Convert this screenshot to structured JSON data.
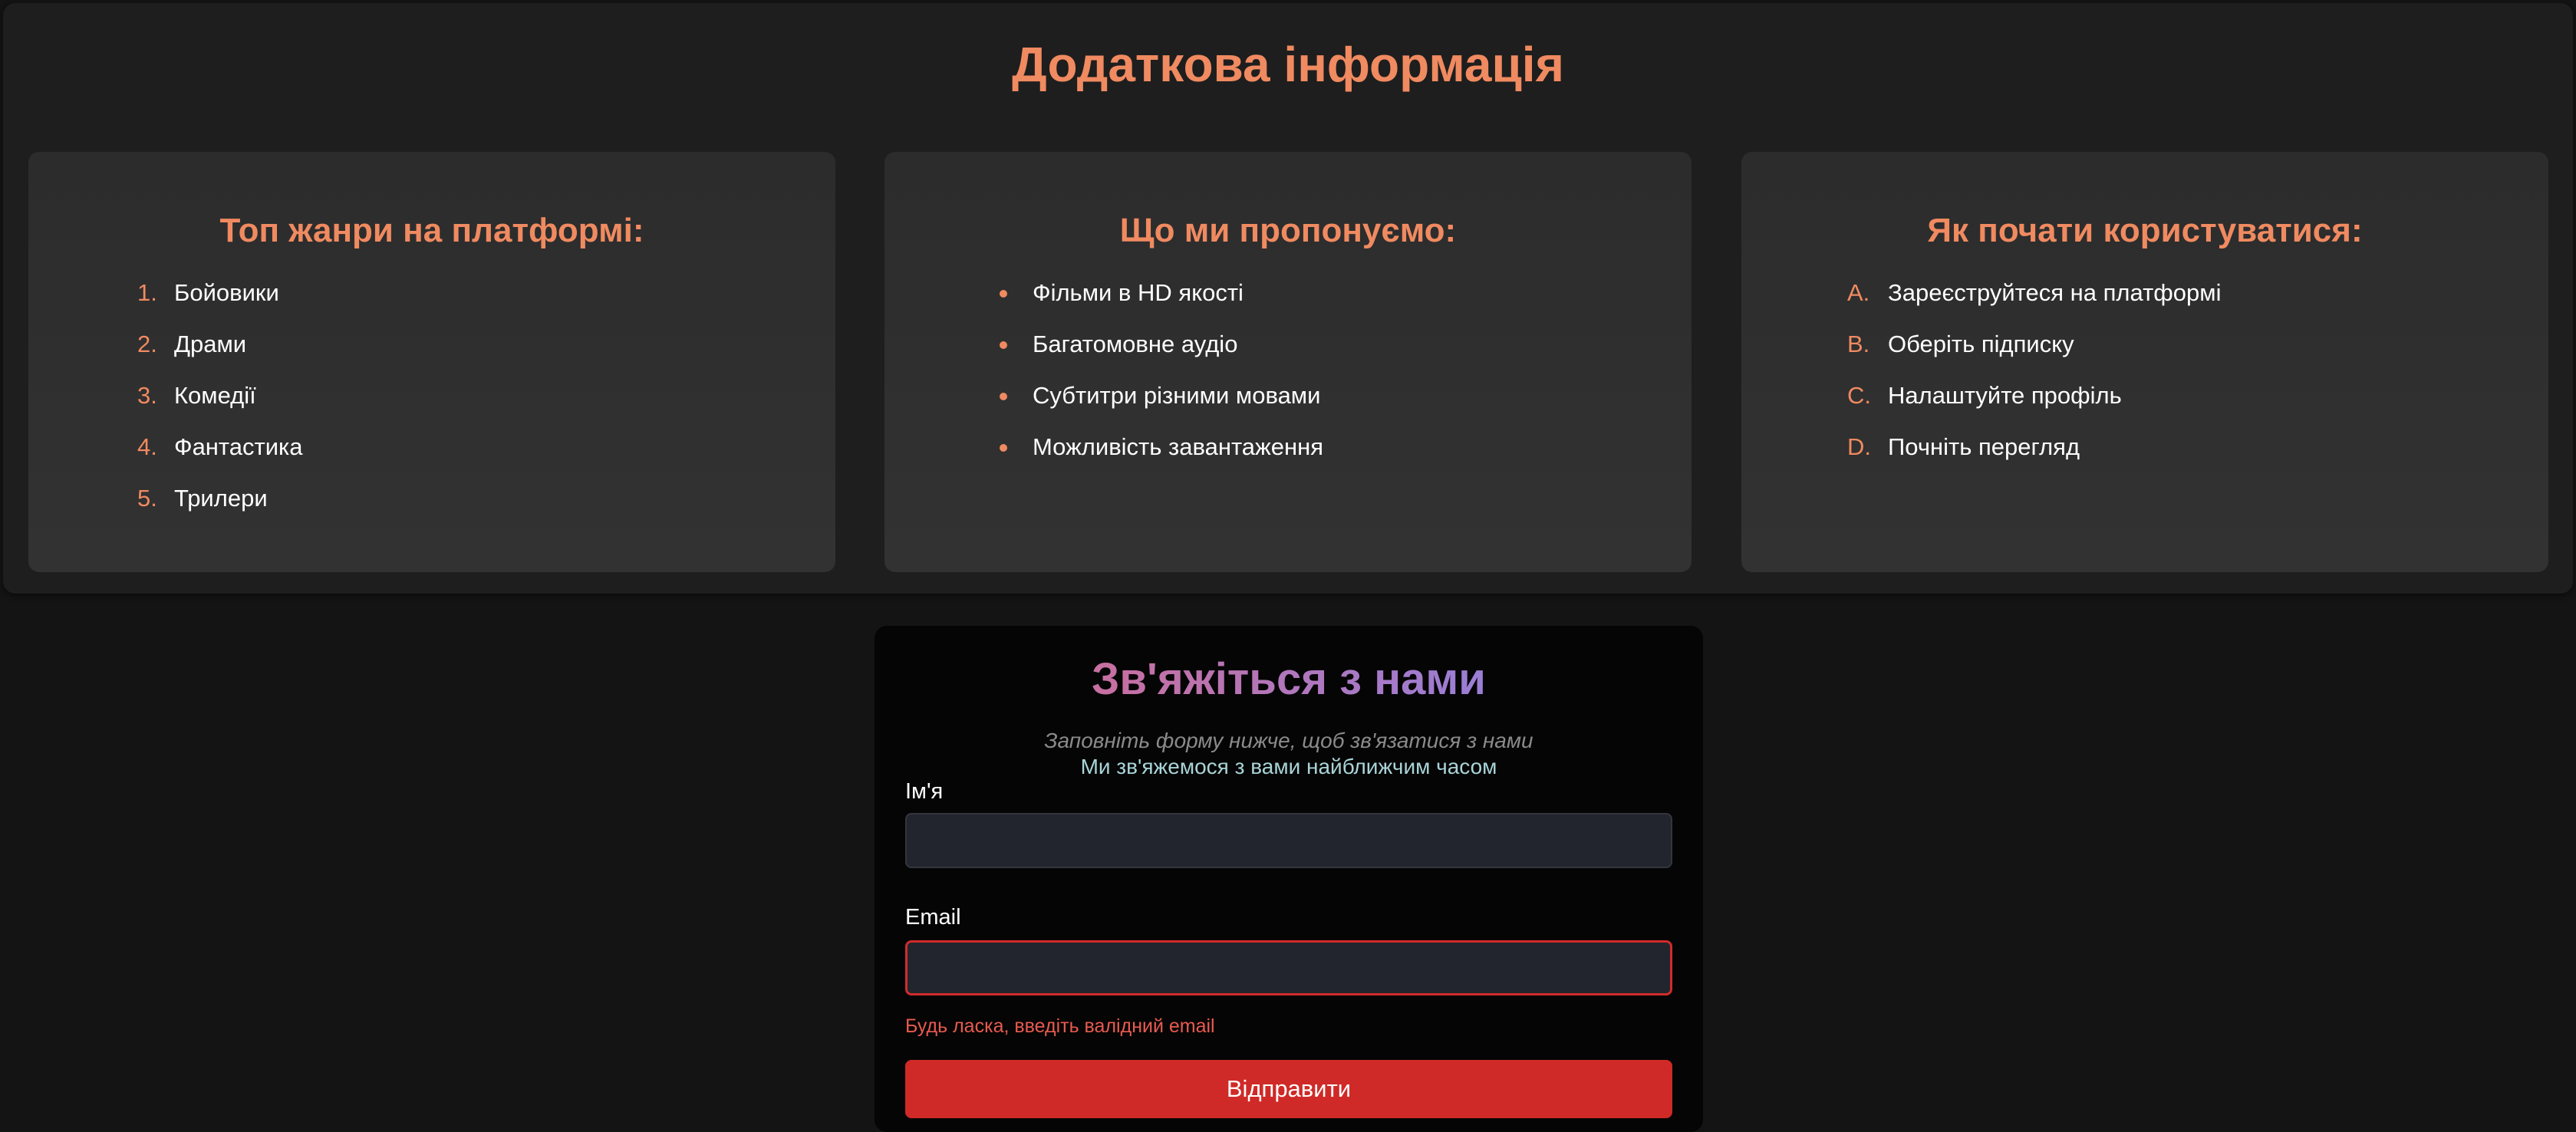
{
  "info": {
    "title": "Додаткова інформація",
    "cards": [
      {
        "title": "Топ жанри на платформі:",
        "markers": [
          "1.",
          "2.",
          "3.",
          "4.",
          "5."
        ],
        "items": [
          "Бойовики",
          "Драми",
          "Комедії",
          "Фантастика",
          "Трилери"
        ]
      },
      {
        "title": "Що ми пропонуємо:",
        "items": [
          "Фільми в HD якості",
          "Багатомовне аудіо",
          "Субтитри різними мовами",
          "Можливість завантаження"
        ]
      },
      {
        "title": "Як почати користуватися:",
        "markers": [
          "A.",
          "B.",
          "C.",
          "D."
        ],
        "items": [
          "Зареєструйтеся на платформі",
          "Оберіть підписку",
          "Налаштуйте профіль",
          "Почніть перегляд"
        ]
      }
    ]
  },
  "contact": {
    "title": "Зв'яжіться з нами",
    "subtitle": "Заповніть форму нижче, щоб зв'язатися з нами",
    "note": "Ми зв'яжемося з вами найближчим часом",
    "name_label": "Ім'я",
    "name_value": "",
    "email_label": "Email",
    "email_value": "",
    "email_error": "Будь ласка, введіть валідний email",
    "submit_label": "Відправити"
  },
  "colors": {
    "accent": "#f08a60",
    "error": "#d02b2b",
    "button": "#cf2a27"
  }
}
